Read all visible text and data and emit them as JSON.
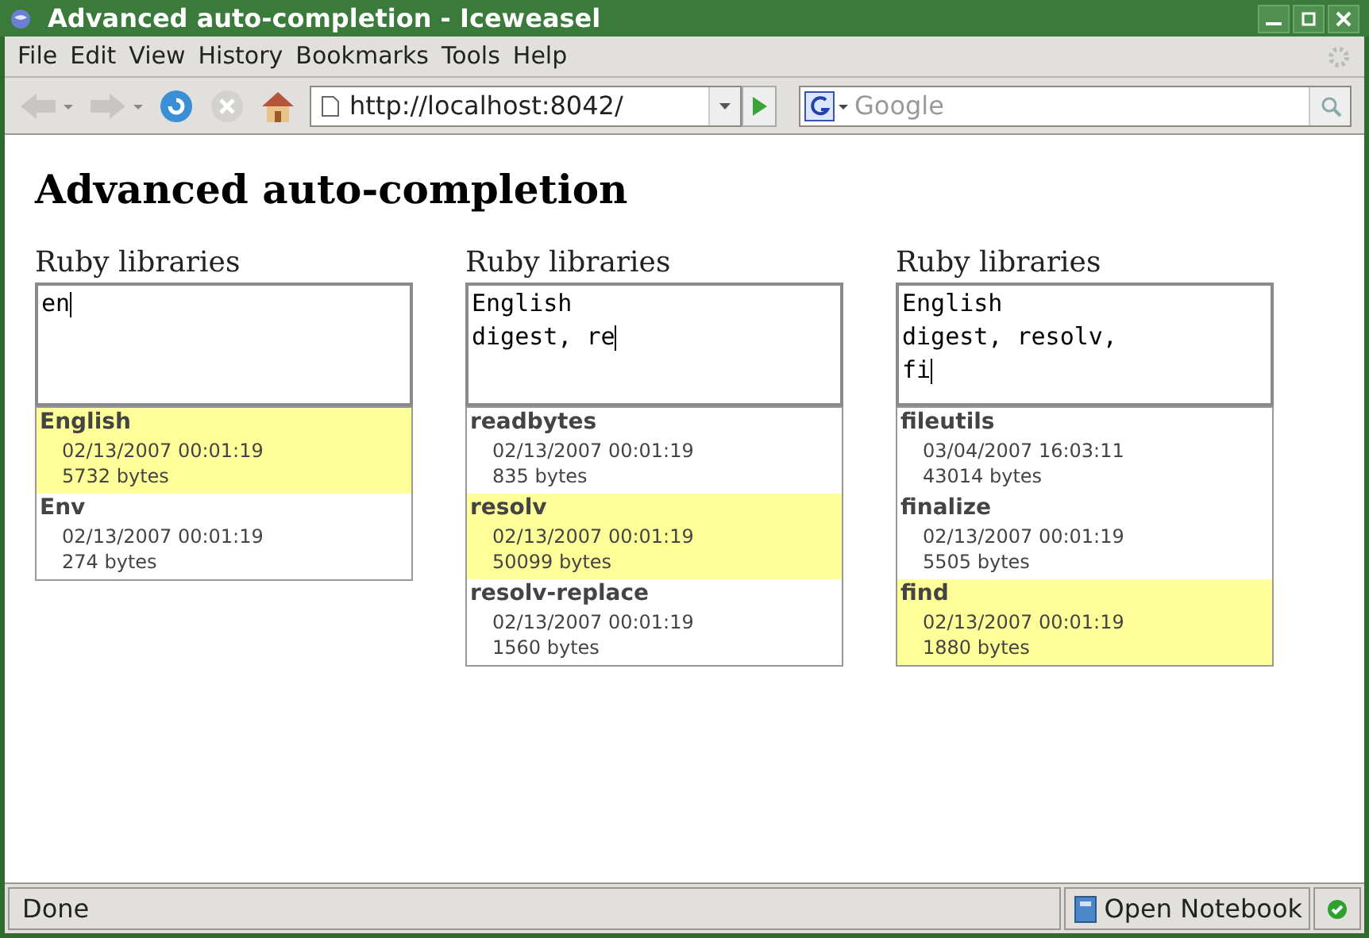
{
  "window": {
    "title": "Advanced auto-completion - Iceweasel"
  },
  "menu": [
    "File",
    "Edit",
    "View",
    "History",
    "Bookmarks",
    "Tools",
    "Help"
  ],
  "toolbar": {
    "url": "http://localhost:8042/",
    "search_placeholder": "Google"
  },
  "page": {
    "heading": "Advanced auto-completion",
    "fields": [
      {
        "label": "Ruby libraries",
        "value": "en",
        "suggestions": [
          {
            "name": "English",
            "date": "02/13/2007 00:01:19",
            "size": "5732 bytes",
            "selected": true
          },
          {
            "name": "Env",
            "date": "02/13/2007 00:01:19",
            "size": "274 bytes",
            "selected": false
          }
        ]
      },
      {
        "label": "Ruby libraries",
        "value": "English\ndigest, re",
        "suggestions": [
          {
            "name": "readbytes",
            "date": "02/13/2007 00:01:19",
            "size": "835 bytes",
            "selected": false
          },
          {
            "name": "resolv",
            "date": "02/13/2007 00:01:19",
            "size": "50099 bytes",
            "selected": true
          },
          {
            "name": "resolv-replace",
            "date": "02/13/2007 00:01:19",
            "size": "1560 bytes",
            "selected": false
          }
        ]
      },
      {
        "label": "Ruby libraries",
        "value": "English\ndigest, resolv,\nfi",
        "suggestions": [
          {
            "name": "fileutils",
            "date": "03/04/2007 16:03:11",
            "size": "43014 bytes",
            "selected": false
          },
          {
            "name": "finalize",
            "date": "02/13/2007 00:01:19",
            "size": "5505 bytes",
            "selected": false
          },
          {
            "name": "find",
            "date": "02/13/2007 00:01:19",
            "size": "1880 bytes",
            "selected": true
          }
        ]
      }
    ]
  },
  "status_bar": {
    "text": "Done",
    "notebook": "Open Notebook"
  }
}
